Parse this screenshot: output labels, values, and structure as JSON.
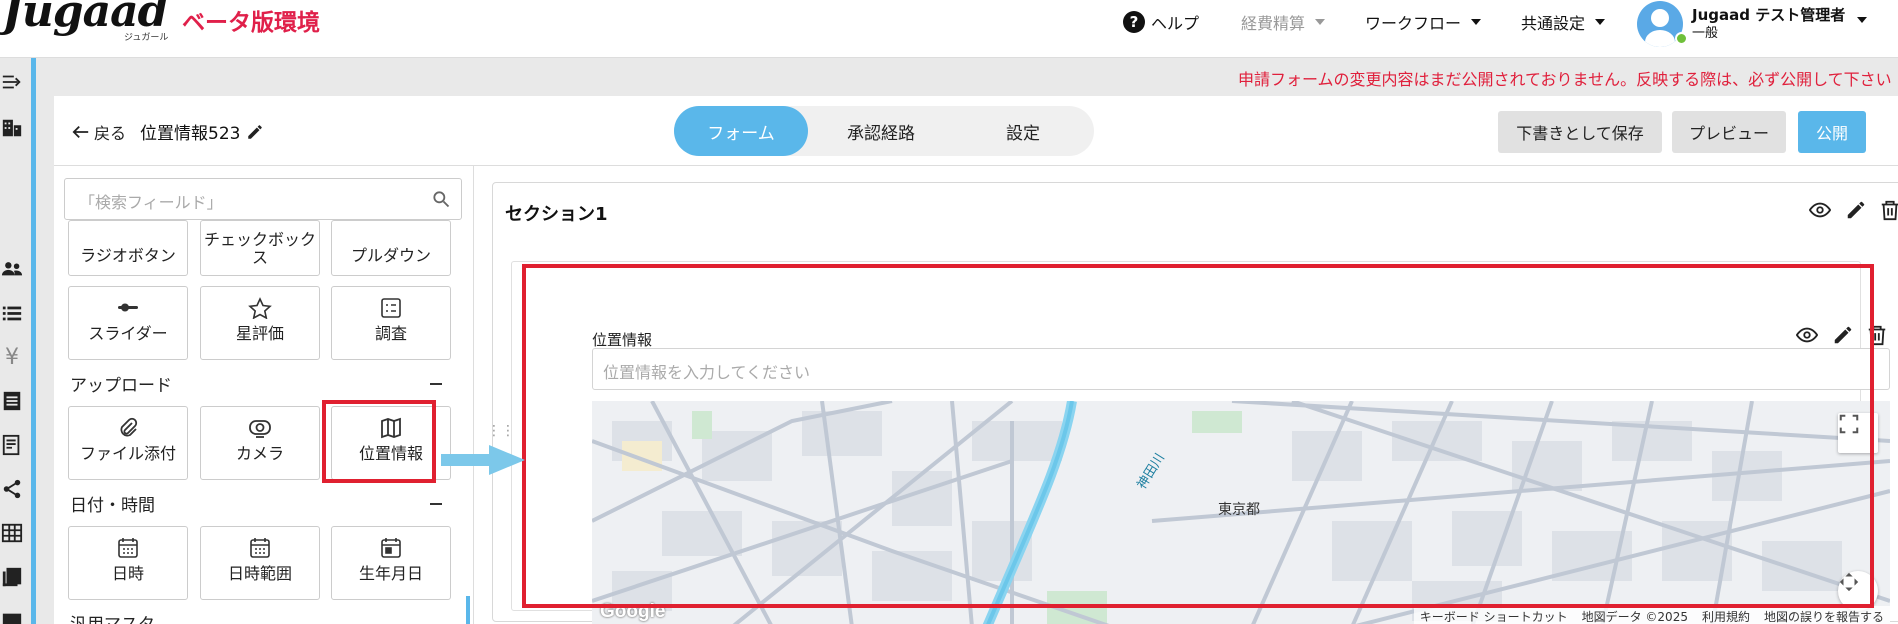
{
  "header": {
    "logo": "Jugaad",
    "logo_sub": "ジュガール",
    "beta_label": "ベータ版環境",
    "nav": {
      "help": "ヘルプ",
      "expense": "経費精算",
      "workflow": "ワークフロー",
      "common_settings": "共通設定"
    },
    "user": {
      "name": "Jugaad テスト管理者",
      "role": "一般"
    }
  },
  "notice": "申請フォームの変更内容はまだ公開されておりません。反映する際は、必ず公開して下さい",
  "form_header": {
    "back_label": "戻る",
    "form_name": "位置情報523",
    "tabs": [
      {
        "label": "フォーム",
        "active": true
      },
      {
        "label": "承認経路",
        "active": false
      },
      {
        "label": "設定",
        "active": false
      }
    ],
    "actions": {
      "save_draft": "下書きとして保存",
      "preview": "プレビュー",
      "publish": "公開"
    }
  },
  "palette": {
    "search_placeholder": "「検索フィールド」",
    "top_row": [
      {
        "label": "ラジオボタン",
        "icon": "radio-icon"
      },
      {
        "label": "チェックボックス",
        "icon": "checkbox-icon"
      },
      {
        "label": "プルダウン",
        "icon": "dropdown-icon"
      }
    ],
    "second_row": [
      {
        "label": "スライダー",
        "icon": "slider-icon"
      },
      {
        "label": "星評価",
        "icon": "star-icon"
      },
      {
        "label": "調査",
        "icon": "survey-icon"
      }
    ],
    "upload_group": {
      "title": "アップロード",
      "items": [
        {
          "label": "ファイル添付",
          "icon": "paperclip-icon"
        },
        {
          "label": "カメラ",
          "icon": "camera-icon"
        },
        {
          "label": "位置情報",
          "icon": "map-icon"
        }
      ]
    },
    "datetime_group": {
      "title": "日付・時間",
      "items": [
        {
          "label": "日時",
          "icon": "calendar-icon"
        },
        {
          "label": "日時範囲",
          "icon": "calendar-range-icon"
        },
        {
          "label": "生年月日",
          "icon": "birthday-calendar-icon"
        }
      ]
    },
    "next_group_partial": "汎用マスタ"
  },
  "canvas": {
    "section_title": "セクション1",
    "field": {
      "label": "位置情報",
      "placeholder": "位置情報を入力してください"
    },
    "map": {
      "place_label": "東京都",
      "river_label": "神田川",
      "attribution": "Google",
      "footer": [
        "キーボード ショートカット",
        "地図データ ©2025",
        "利用規約",
        "地図の誤りを報告する"
      ]
    }
  },
  "colors": {
    "accent": "#5ab7ea",
    "beta": "#e0204a",
    "highlight": "#e02030",
    "notice": "#e0203c"
  }
}
